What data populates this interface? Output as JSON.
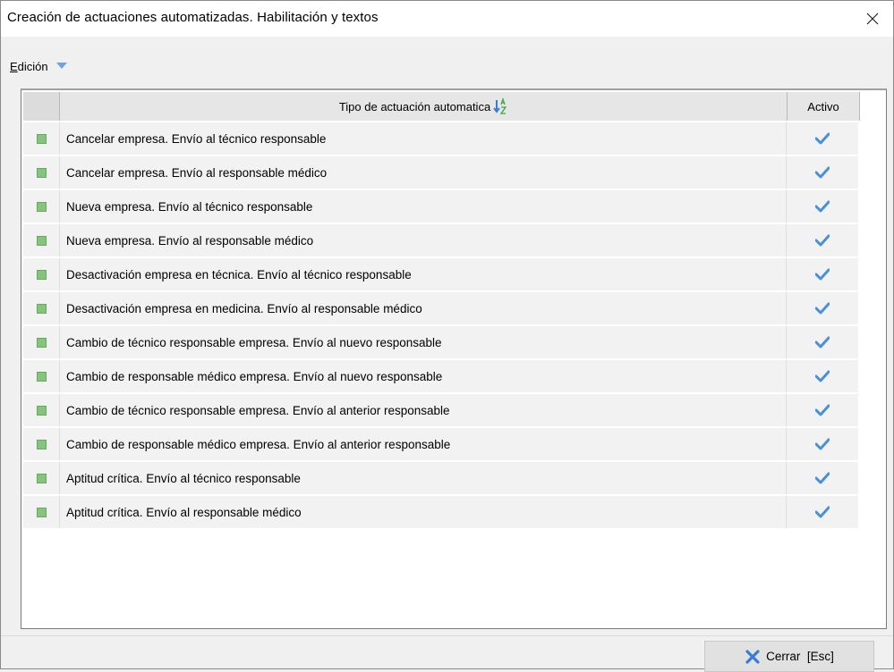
{
  "window": {
    "title": "Creación de actuaciones automatizadas. Habilitación y textos"
  },
  "menu": {
    "edicion_first": "E",
    "edicion_rest": "dición"
  },
  "grid": {
    "columns": {
      "tipo": "Tipo de actuación automatica",
      "activo": "Activo"
    },
    "rows": [
      {
        "tipo": "Cancelar empresa. Envío al técnico responsable",
        "activo": true
      },
      {
        "tipo": "Cancelar empresa. Envío al responsable médico",
        "activo": true
      },
      {
        "tipo": "Nueva empresa. Envío al técnico responsable",
        "activo": true
      },
      {
        "tipo": "Nueva empresa. Envío al responsable médico",
        "activo": true
      },
      {
        "tipo": "Desactivación empresa en técnica. Envío al técnico responsable",
        "activo": true
      },
      {
        "tipo": "Desactivación empresa en medicina. Envío al responsable médico",
        "activo": true
      },
      {
        "tipo": "Cambio de técnico responsable empresa. Envío al nuevo responsable",
        "activo": true
      },
      {
        "tipo": "Cambio de responsable médico empresa. Envío al nuevo responsable",
        "activo": true
      },
      {
        "tipo": "Cambio de técnico responsable empresa. Envío al anterior responsable",
        "activo": true
      },
      {
        "tipo": "Cambio de responsable médico empresa. Envío al anterior responsable",
        "activo": true
      },
      {
        "tipo": "Aptitud crítica. Envío al técnico responsable",
        "activo": true
      },
      {
        "tipo": "Aptitud crítica. Envío al responsable médico",
        "activo": true
      }
    ]
  },
  "footer": {
    "close_label": "Cerrar  [Esc]"
  },
  "colors": {
    "check": "#4a90d9",
    "indicator": "#84c47c",
    "close_x": "#3a7bd5",
    "sort_blue": "#3a7bd5",
    "sort_green": "#3aaa3a"
  },
  "icons": {
    "close": "close-icon",
    "dropdown": "chevron-down-icon",
    "sort": "sort-az-icon",
    "check": "checkmark-icon",
    "cerrar": "x-icon"
  }
}
